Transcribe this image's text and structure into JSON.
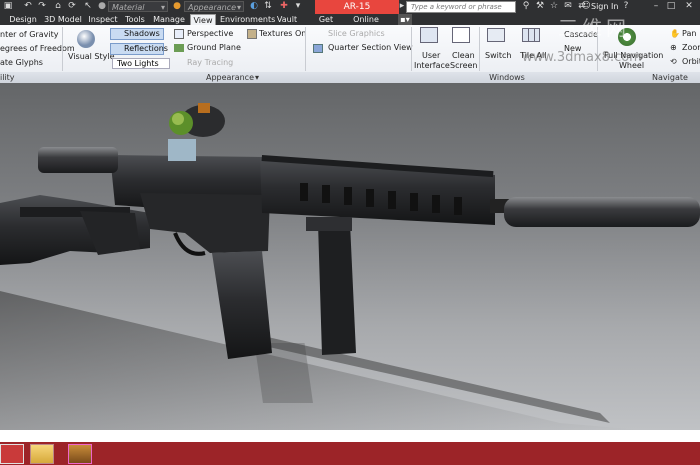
{
  "window": {
    "document_title": "AR-15"
  },
  "qat": {
    "material": "Material",
    "appearance": "Appearance"
  },
  "search": {
    "placeholder": "Type a keyword or phrase"
  },
  "account": {
    "sign_in": "Sign In"
  },
  "tabs": [
    "Design",
    "3D Model",
    "Inspect",
    "Tools",
    "Manage",
    "View",
    "Environments",
    "Vault",
    "Get Started",
    "Online"
  ],
  "active_tab": "View",
  "ribbon": {
    "visibility": {
      "items": [
        "nter of Gravity",
        "egrees of Freedom",
        "ate Glyphs"
      ],
      "panel_label": "ility"
    },
    "appearance": {
      "visual_style": "Visual Style",
      "shadows": "Shadows",
      "reflections": "Reflections",
      "lighting": "Two Lights",
      "perspective": "Perspective",
      "ground_plane": "Ground Plane",
      "ray_tracing": "Ray Tracing",
      "textures": "Textures On",
      "slice_graphics": "Slice Graphics",
      "quarter_section": "Quarter Section View",
      "panel_label": "Appearance"
    },
    "windows": {
      "user_interface": [
        "User",
        "Interface"
      ],
      "clean_screen": [
        "Clean",
        "Screen"
      ],
      "switch": "Switch",
      "tile_all": "Tile All",
      "cascade": "Cascade",
      "new": "New",
      "panel_label": "Windows"
    },
    "navigate": {
      "full_nav_wheel": [
        "Full Navigation",
        "Wheel"
      ],
      "pan": "Pan",
      "zoom": "Zoom",
      "orbit": "Orbit",
      "panel_label": "Navigate"
    }
  },
  "watermark": {
    "line1": "三维网",
    "line2": "www.3dmax8.com"
  },
  "colors": {
    "title_bar": "#2f3032",
    "doc_title_bg": "#e8463e",
    "taskbar": "#9c2428",
    "rifle_body": "#2a2b2d"
  }
}
